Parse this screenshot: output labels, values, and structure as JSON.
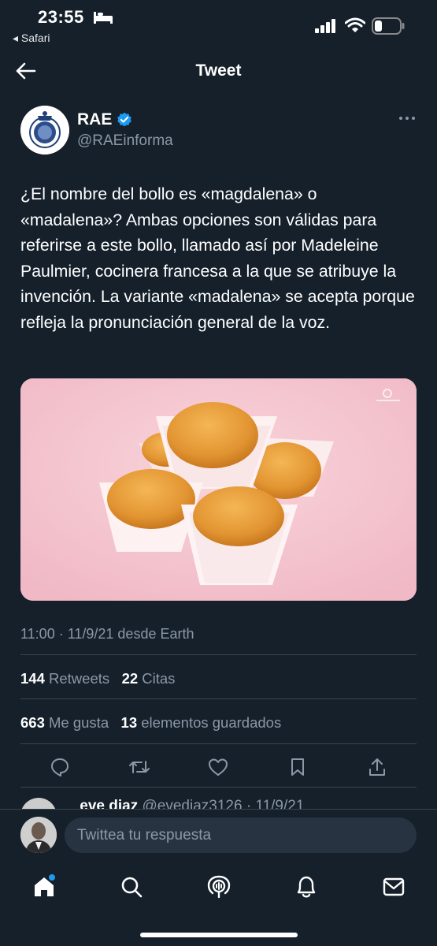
{
  "status_bar": {
    "time": "23:55",
    "back_app": "◂ Safari"
  },
  "header": {
    "title": "Tweet"
  },
  "tweet": {
    "name": "RAE",
    "handle": "@RAEinforma",
    "text": "¿El nombre del bollo es «magdalena» o «madalena»? Ambas opciones son válidas para referirse a este bollo, llamado así por Madeleine Paulmier, cocinera francesa a la que se atribuye la invención. La variante «madalena» se acepta porque refleja la pronunciación general de la voz.",
    "meta": "11:00 · 11/9/21 desde Earth",
    "retweets_count": "144",
    "retweets_label": "Retweets",
    "quotes_count": "22",
    "quotes_label": "Citas",
    "likes_count": "663",
    "likes_label": "Me gusta",
    "bookmarks_count": "13",
    "bookmarks_label": "elementos guardados"
  },
  "reply_peek": {
    "name": "eve diaz",
    "handle_date": "@evediaz3126 · 11/9/21"
  },
  "reply_input": {
    "placeholder": "Twittea tu respuesta"
  },
  "colors": {
    "background": "#15202b",
    "accent": "#1d9bf0",
    "muted": "#8b98a5",
    "divider": "#38444d"
  },
  "icons": [
    "back-arrow-icon",
    "verified-badge-icon",
    "more-icon",
    "reply-icon",
    "retweet-icon",
    "like-icon",
    "bookmark-icon",
    "share-icon",
    "home-icon",
    "search-icon",
    "spaces-icon",
    "notifications-icon",
    "messages-icon"
  ]
}
